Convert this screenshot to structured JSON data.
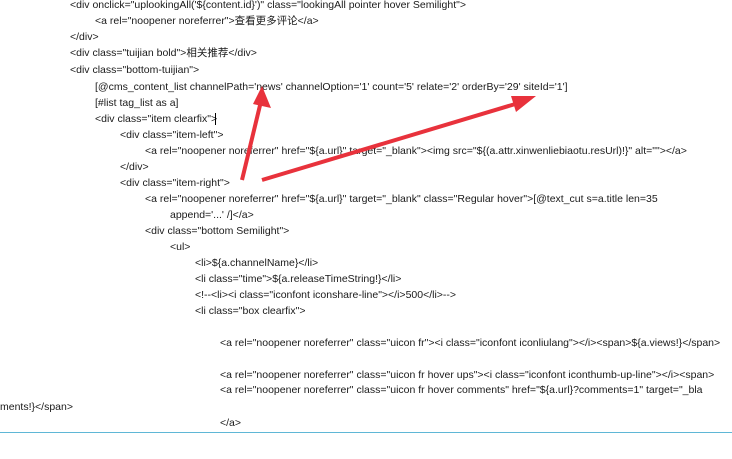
{
  "code_lines": [
    "<div onclick=\"uplookingAll('${content.id}')\" class=\"lookingAll pointer hover Semilight\">",
    "<a rel=\"noopener noreferrer\">查看更多评论</a>",
    "</div>",
    "<div class=\"tuijian bold\">相关推荐</div>",
    "<div class=\"bottom-tuijian\">",
    "[@cms_content_list channelPath='news' channelOption='1' count='5' relate='2' orderBy='29' siteId='1']",
    "[#list tag_list as a]",
    "<div class=\"item clearfix\">",
    "<div class=\"item-left\">",
    "<a rel=\"noopener noreferrer\" href=\"${a.url}\" target=\"_blank\"><img src=\"${(a.attr.xinwenliebiaotu.resUrl)!}\" alt=\"\"></a>",
    "</div>",
    "<div class=\"item-right\">",
    "<a rel=\"noopener noreferrer\" href=\"${a.url}\" target=\"_blank\" class=\"Regular hover\">[@text_cut s=a.title len=35",
    "append='...' /]</a>",
    "<div class=\"bottom Semilight\">",
    "<ul>",
    "<li>${a.channelName}</li>",
    "<li class=\"time\">${a.releaseTimeString!}</li>",
    "<!--<li><i class=\"iconfont iconshare-line\"></i>500</li>-->",
    "<li class=\"box clearfix\">",
    "<a rel=\"noopener noreferrer\" class=\"uicon fr\"><i class=\"iconfont iconliulang\"></i><span>${a.views!}</span>",
    "<a rel=\"noopener noreferrer\" class=\"uicon fr hover ups\"><i class=\"iconfont iconthumb-up-line\"></i><span>",
    "<a rel=\"noopener noreferrer\" class=\"uicon fr hover comments\" href=\"${a.url}?comments=1\" target=\"_bla",
    "ments!}</span>",
    "</a>"
  ],
  "annotation_color": "#e8323c",
  "rule_color": "#5fb7d6"
}
